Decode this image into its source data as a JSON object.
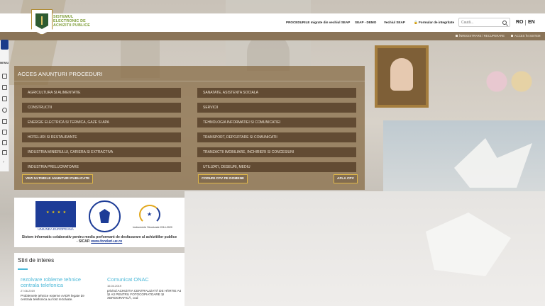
{
  "header": {
    "logo_text": "SISTEMUL ELECTRONIC DE ACHIZITII PUBLICE",
    "nav": [
      "PROCEDURILE migrate din vechiul SEAP",
      "SEAP - DEMO",
      "Vechiul SEAP",
      "Formular de integritate"
    ],
    "search_placeholder": "Caută...",
    "lang_ro": "RO",
    "lang_en": "EN"
  },
  "subbar": {
    "register": "ÎNREGISTRARE / RECUPERARE",
    "access": "ACCES ÎN SISTEM"
  },
  "sidebar": {
    "menu_label": "MENIU"
  },
  "panel": {
    "title": "ACCES ANUNȚURI PROCEDURI",
    "left_categories": [
      "AGRICULTURA SI ALIMENTATIE",
      "CONSTRUCTII",
      "ENERGIE ELECTRICA SI TERMICA, GAZE SI APA",
      "HOTELURI SI RESTAURANTE",
      "INDUSTRIA MINIERULUI, CARIERA SI EXTRACTIVA",
      "INDUSTRIA PRELUCRATOARE"
    ],
    "right_categories": [
      "SANATATE, ASISTENTA SOCIALA",
      "SERVICII",
      "TEHNOLOGIA INFORMATIEI SI COMUNICATIEI",
      "TRANSPORT, DEPOZITARE SI COMUNICATII",
      "TRANZACTII IMOBILIARE, INCHIRIERI SI CONCESIUNI",
      "UTILIZATI, DESEURI, MEDIU"
    ],
    "btn_latest": "VEZI ULTIMELE ANUNTURI PUBLICATE",
    "btn_cpv_domain": "CODURI CPV PE DOMENII",
    "btn_find_cpv": "AFLA CPV"
  },
  "eu_banner": {
    "eu_caption": "UNIUNEA EUROPEANĂ",
    "is_caption": "Instrumente Structurale 2014-2020",
    "description": "Sistem informatic colaborativ pentru mediu performant de desfasurare al achizitiilor publice - SICAP.",
    "link": "www.fonduri-ue.ro"
  },
  "news": {
    "title": "Stiri de interes",
    "items": [
      {
        "headline": "rezolvare roblemе tehnice centrala telefonica",
        "date": "27.06.2019",
        "text": "Problemele tehnice externe AADR legate de centrala telefonica au fost rezolvate."
      },
      {
        "headline": "Comunicat ONAC",
        "date": "16.04.2019",
        "text": "privind ACHIZITIA CENTRALIZATĂ DE HÂRTIE A4 ȘI A3 PENTRU FOTOCOPIATOARE ȘI XEROGRAFICĂ, cod"
      }
    ]
  },
  "colors": {
    "panel_bg": "#8a6f4a",
    "category_bg": "#624b33",
    "button_border": "#e0b847",
    "news_accent": "#4bb8d8",
    "eu_blue": "#1d3c97"
  }
}
